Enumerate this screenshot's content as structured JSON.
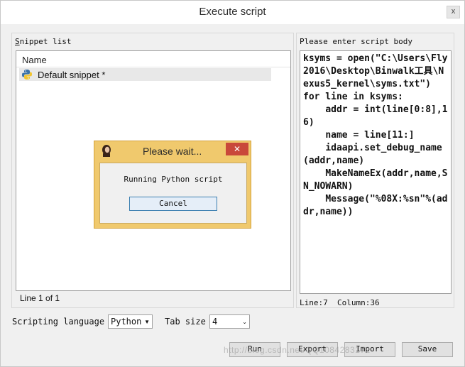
{
  "window": {
    "title": "Execute script",
    "close_glyph": "x"
  },
  "snippets": {
    "label": "Snippet list",
    "column_header": "Name",
    "items": [
      {
        "label": "Default snippet *",
        "icon": "python-icon"
      }
    ],
    "status": "Line 1 of 1"
  },
  "editor": {
    "label": "Please enter script body",
    "code": "ksyms = open(\"C:\\Users\\Fly2016\\Desktop\\Binwalk工具\\Nexus5_kernel\\syms.txt\")\nfor line in ksyms:\n    addr = int(line[0:8],16)\n    name = line[11:]\n    idaapi.set_debug_name(addr,name)\n    MakeNameEx(addr,name,SN_NOWARN)\n    Message(\"%08X:%sn\"%(addr,name))",
    "status_line": "Line:7",
    "status_col": "Column:36"
  },
  "options": {
    "language_label": "Scripting language",
    "language_value": "Python",
    "tabsize_label": "Tab size",
    "tabsize_value": "4"
  },
  "buttons": {
    "run": "Run",
    "export": "Export",
    "import": "Import",
    "save": "Save"
  },
  "watermark": "http://blog.csdn.net/QQ1084283172",
  "dialog": {
    "title": "Please wait...",
    "message": "Running Python script",
    "cancel": "Cancel",
    "close_glyph": "✕"
  },
  "colors": {
    "dialog_bg": "#f0c96d",
    "dialog_close": "#c9483a",
    "selection": "#e8e8e8"
  }
}
